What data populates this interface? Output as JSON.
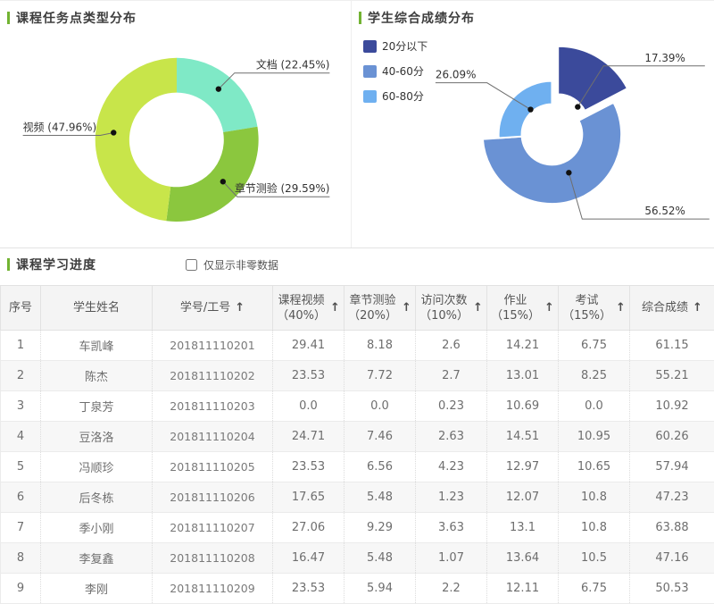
{
  "charts": {
    "task": {
      "title": "课程任务点类型分布",
      "slices": [
        {
          "name": "文档",
          "pct": 22.45,
          "display": "文档 (22.45%)",
          "color": "#7fe9c6"
        },
        {
          "name": "章节测验",
          "pct": 29.59,
          "display": "章节测验 (29.59%)",
          "color": "#8bc73e"
        },
        {
          "name": "视频",
          "pct": 47.96,
          "display": "视频 (47.96%)",
          "color": "#c8e54a"
        }
      ]
    },
    "score": {
      "title": "学生综合成绩分布",
      "legend": [
        {
          "label": "20分以下",
          "color": "#3b4a9b"
        },
        {
          "label": "40-60分",
          "color": "#6a92d4"
        },
        {
          "label": "60-80分",
          "color": "#6fb0f0"
        }
      ],
      "labels": {
        "low": "17.39%",
        "mid": "56.52%",
        "high": "26.09%"
      }
    }
  },
  "chart_data": [
    {
      "type": "pie",
      "title": "课程任务点类型分布",
      "style": "donut",
      "labels": [
        "文档",
        "章节测验",
        "视频"
      ],
      "values": [
        22.45,
        29.59,
        47.96
      ],
      "unit": "%",
      "colors": [
        "#7fe9c6",
        "#8bc73e",
        "#c8e54a"
      ],
      "legend_position": "none"
    },
    {
      "type": "pie",
      "title": "学生综合成绩分布",
      "style": "rose-donut, first slice exploded/selected",
      "labels": [
        "20分以下",
        "40-60分",
        "60-80分"
      ],
      "values": [
        17.39,
        56.52,
        26.09
      ],
      "unit": "%",
      "colors": [
        "#3b4a9b",
        "#6a92d4",
        "#6fb0f0"
      ],
      "legend_position": "top-left"
    }
  ],
  "table": {
    "section_title": "课程学习进度",
    "checkbox_label": "仅显示非零数据",
    "sort_icon": "↑",
    "columns": [
      {
        "key": "serial",
        "line1": "序号",
        "line2": "",
        "sortable": false
      },
      {
        "key": "name",
        "line1": "学生姓名",
        "line2": "",
        "sortable": false
      },
      {
        "key": "id",
        "line1": "学号/工号",
        "line2": "",
        "sortable": true
      },
      {
        "key": "video",
        "line1": "课程视频",
        "line2": "（40%）",
        "sortable": true
      },
      {
        "key": "quiz",
        "line1": "章节测验",
        "line2": "（20%）",
        "sortable": true
      },
      {
        "key": "visits",
        "line1": "访问次数",
        "line2": "（10%）",
        "sortable": true
      },
      {
        "key": "homework",
        "line1": "作业",
        "line2": "（15%）",
        "sortable": true
      },
      {
        "key": "exam",
        "line1": "考试",
        "line2": "（15%）",
        "sortable": true
      },
      {
        "key": "total",
        "line1": "综合成绩",
        "line2": "",
        "sortable": true
      }
    ],
    "rows": [
      [
        "1",
        "车凯峰",
        "201811110201",
        "29.41",
        "8.18",
        "2.6",
        "14.21",
        "6.75",
        "61.15"
      ],
      [
        "2",
        "陈杰",
        "201811110202",
        "23.53",
        "7.72",
        "2.7",
        "13.01",
        "8.25",
        "55.21"
      ],
      [
        "3",
        "丁泉芳",
        "201811110203",
        "0.0",
        "0.0",
        "0.23",
        "10.69",
        "0.0",
        "10.92"
      ],
      [
        "4",
        "豆洛洛",
        "201811110204",
        "24.71",
        "7.46",
        "2.63",
        "14.51",
        "10.95",
        "60.26"
      ],
      [
        "5",
        "冯顺珍",
        "201811110205",
        "23.53",
        "6.56",
        "4.23",
        "12.97",
        "10.65",
        "57.94"
      ],
      [
        "6",
        "后冬栋",
        "201811110206",
        "17.65",
        "5.48",
        "1.23",
        "12.07",
        "10.8",
        "47.23"
      ],
      [
        "7",
        "季小刚",
        "201811110207",
        "27.06",
        "9.29",
        "3.63",
        "13.1",
        "10.8",
        "63.88"
      ],
      [
        "8",
        "李复鑫",
        "201811110208",
        "16.47",
        "5.48",
        "1.07",
        "13.64",
        "10.5",
        "47.16"
      ],
      [
        "9",
        "李刚",
        "201811110209",
        "23.53",
        "5.94",
        "2.2",
        "12.11",
        "6.75",
        "50.53"
      ]
    ]
  }
}
